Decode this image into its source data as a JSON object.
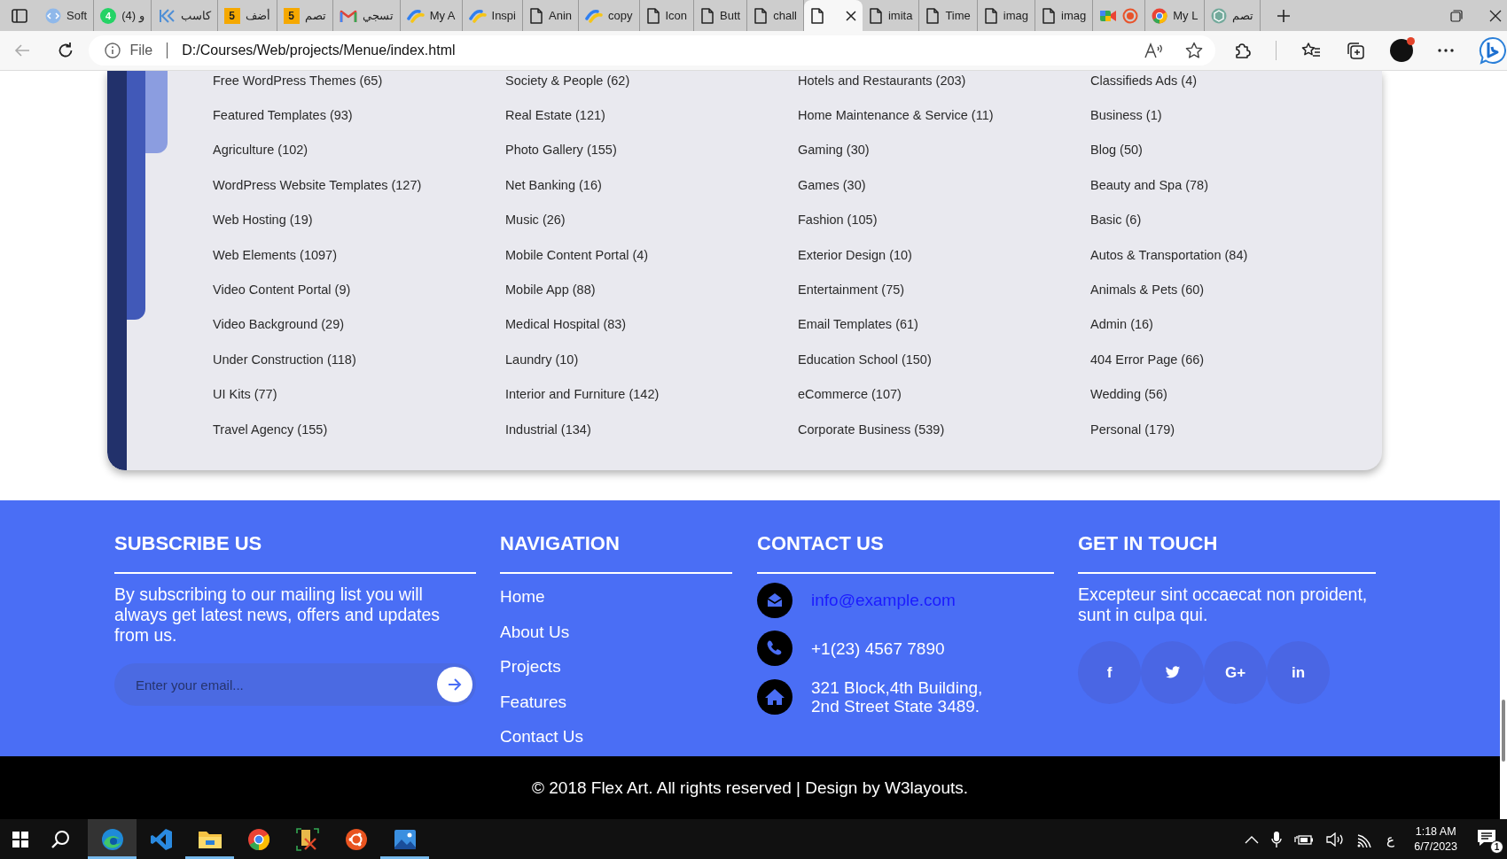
{
  "browser": {
    "tabs": [
      {
        "kind": "site",
        "label": "Soft",
        "selected": false
      },
      {
        "kind": "count",
        "icon_text": "4",
        "label": "(4) و",
        "selected": false
      },
      {
        "kind": "chevron",
        "label": "كاسب",
        "selected": false
      },
      {
        "kind": "number",
        "icon_text": "5",
        "label": "أضف",
        "selected": false
      },
      {
        "kind": "number",
        "icon_text": "5",
        "label": "تصم",
        "selected": false
      },
      {
        "kind": "mail",
        "label": "تسجي",
        "selected": false
      },
      {
        "kind": "swoosh",
        "label": "My A",
        "selected": false
      },
      {
        "kind": "swoosh",
        "label": "Inspi",
        "selected": false
      },
      {
        "kind": "doc",
        "label": "Anin",
        "selected": false
      },
      {
        "kind": "swoosh",
        "label": "copy",
        "selected": false
      },
      {
        "kind": "doc",
        "label": "Icon",
        "selected": false
      },
      {
        "kind": "doc",
        "label": "Butt",
        "selected": false
      },
      {
        "kind": "doc",
        "label": "chall",
        "selected": false
      },
      {
        "kind": "doc",
        "selected": true
      },
      {
        "kind": "doc",
        "label": "imita",
        "selected": false
      },
      {
        "kind": "doc",
        "label": "Time",
        "selected": false
      },
      {
        "kind": "doc",
        "label": "imag",
        "selected": false
      },
      {
        "kind": "doc",
        "label": "imag",
        "selected": false
      },
      {
        "kind": "camera",
        "recording": true,
        "selected": false
      },
      {
        "kind": "browser",
        "label": "My L",
        "selected": false
      },
      {
        "kind": "knot",
        "label": "تصم",
        "selected": false
      }
    ],
    "address": {
      "scheme": "File",
      "url": "D:/Courses/Web/projects/Menue/index.html"
    }
  },
  "categories": {
    "columns": [
      [
        "Free WordPress Themes (65)",
        "Featured Templates (93)",
        "Agriculture (102)",
        "WordPress Website Templates (127)",
        "Web Hosting (19)",
        "Web Elements (1097)",
        "Video Content Portal (9)",
        "Video Background (29)",
        "Under Construction (118)",
        "UI Kits (77)",
        "Travel Agency (155)"
      ],
      [
        "Society & People (62)",
        "Real Estate (121)",
        "Photo Gallery (155)",
        "Net Banking (16)",
        "Music (26)",
        "Mobile Content Portal (4)",
        "Mobile App (88)",
        "Medical Hospital (83)",
        "Laundry (10)",
        "Interior and Furniture (142)",
        "Industrial (134)"
      ],
      [
        "Hotels and Restaurants (203)",
        "Home Maintenance & Service (11)",
        "Gaming (30)",
        "Games (30)",
        "Fashion (105)",
        "Exterior Design (10)",
        "Entertainment (75)",
        "Email Templates (61)",
        "Education School (150)",
        "eCommerce (107)",
        "Corporate Business (539)"
      ],
      [
        "Classifieds Ads (4)",
        "Business (1)",
        "Blog (50)",
        "Beauty and Spa (78)",
        "Basic (6)",
        "Autos & Transportation (84)",
        "Animals & Pets (60)",
        "Admin (16)",
        "404 Error Page (66)",
        "Wedding (56)",
        "Personal (179)"
      ]
    ]
  },
  "footer": {
    "subscribe": {
      "heading": "SUBSCRIBE US",
      "text": "By subscribing to our mailing list you will always get latest news, offers and updates from us.",
      "placeholder": "Enter your email..."
    },
    "navigation": {
      "heading": "NAVIGATION",
      "links": [
        "Home",
        "About Us",
        "Projects",
        "Features",
        "Contact Us"
      ]
    },
    "contact": {
      "heading": "CONTACT US",
      "items": [
        {
          "kind": "email",
          "text": "info@example.com"
        },
        {
          "kind": "phone",
          "text": "+1(23) 4567 7890"
        },
        {
          "kind": "address",
          "text": "321 Block,4th Building,\n2nd Street State 3489."
        }
      ]
    },
    "touch": {
      "heading": "GET IN TOUCH",
      "text": "Excepteur sint occaecat non proident, sunt in culpa qui.",
      "socials": [
        {
          "kind": "facebook",
          "label": "f"
        },
        {
          "kind": "twitter"
        },
        {
          "kind": "google",
          "label": "G+"
        },
        {
          "kind": "linkedin",
          "label": "in"
        }
      ]
    },
    "copyright": "© 2018 Flex Art. All rights reserved | Design by W3layouts."
  },
  "taskbar": {
    "apps": [
      {
        "kind": "edge",
        "selected": true,
        "running": true
      },
      {
        "kind": "code",
        "selected": false,
        "running": false
      },
      {
        "kind": "folder",
        "selected": false,
        "running": true
      },
      {
        "kind": "chrome",
        "selected": false,
        "running": false
      },
      {
        "kind": "tools",
        "selected": false,
        "running": false
      },
      {
        "kind": "ubuntu",
        "selected": false,
        "running": false
      },
      {
        "kind": "photos",
        "selected": false,
        "running": true
      }
    ],
    "language": "ع",
    "time": "1:18 AM",
    "date": "6/7/2023",
    "notifications": "1"
  }
}
